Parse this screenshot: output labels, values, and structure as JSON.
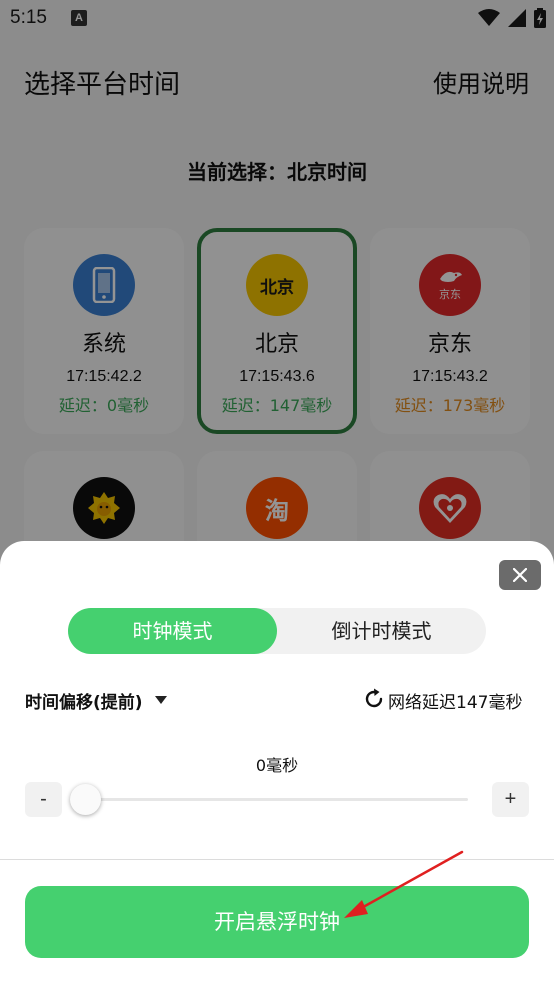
{
  "status_bar": {
    "time": "5:15",
    "notification_glyph": "A"
  },
  "header": {
    "title": "选择平台时间",
    "help_label": "使用说明"
  },
  "current_selection": "当前选择：北京时间",
  "platforms": [
    {
      "name": "系统",
      "time": "17:15:42.2",
      "delay": "延迟：0毫秒",
      "delay_color": "#3aa758",
      "logo_color": "#3a7fd0",
      "icon": "phone-icon"
    },
    {
      "name": "北京",
      "time": "17:15:43.6",
      "delay": "延迟：147毫秒",
      "delay_color": "#3aa758",
      "logo_color": "#f5c400",
      "logo_text": "北京",
      "icon": "beijing-logo"
    },
    {
      "name": "京东",
      "time": "17:15:43.2",
      "delay": "延迟：173毫秒",
      "delay_color": "#e08a1e",
      "logo_color": "#e0282a",
      "logo_text": "京东",
      "icon": "jd-logo"
    }
  ],
  "platforms_row2_icons": [
    "suning-logo",
    "taobao-logo",
    "pinduoduo-logo"
  ],
  "sheet": {
    "modes": {
      "clock": "时钟模式",
      "countdown": "倒计时模式",
      "active": "clock"
    },
    "offset_label": "时间偏移(提前)",
    "network_delay": "网络延迟147毫秒",
    "slider": {
      "value_label": "0毫秒",
      "value": 0,
      "minus": "-",
      "plus": "+"
    },
    "start_button": "开启悬浮时钟"
  },
  "colors": {
    "accent": "#45d06f",
    "selected_border": "#2e7d3f",
    "annotation_arrow": "#e02020"
  }
}
